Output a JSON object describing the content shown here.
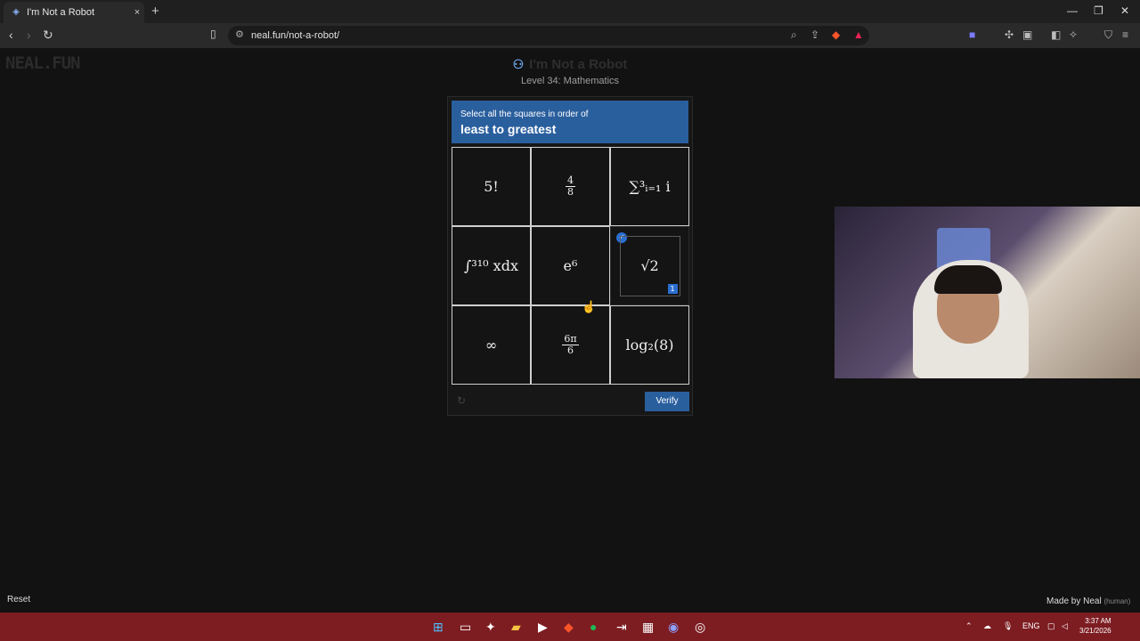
{
  "browser": {
    "tab_title": "I'm Not a Robot",
    "tab_close": "×",
    "new_tab": "+",
    "url": "neal.fun/not-a-robot/",
    "win_min": "—",
    "win_max": "❐",
    "win_close": "✕"
  },
  "page": {
    "logo": "NEAL.FUN",
    "title": "I'm Not a Robot",
    "level": "Level 34: Mathematics",
    "reset": "Reset",
    "made_by": "Made by Neal",
    "made_by_note": "(human)"
  },
  "captcha": {
    "instruction": "Select all the squares in order of",
    "instruction_emphasis": "least to greatest",
    "verify_label": "Verify",
    "cells": [
      {
        "expr": "5!",
        "selected": false
      },
      {
        "expr_num": "4",
        "expr_den": "8",
        "selected": false
      },
      {
        "expr": "∑³ᵢ₌₁ i",
        "selected": false
      },
      {
        "expr": "∫³¹⁰ xdx",
        "selected": false
      },
      {
        "expr": "e⁶",
        "selected": false
      },
      {
        "expr": "√2",
        "selected": true,
        "order": "1"
      },
      {
        "expr": "∞",
        "selected": false
      },
      {
        "expr_num": "6π",
        "expr_den": "6",
        "selected": false
      },
      {
        "expr": "log₂(8)",
        "selected": false
      }
    ]
  },
  "taskbar": {
    "lang": "ENG",
    "time": "3:37 AM",
    "date": "3/21/2026"
  }
}
